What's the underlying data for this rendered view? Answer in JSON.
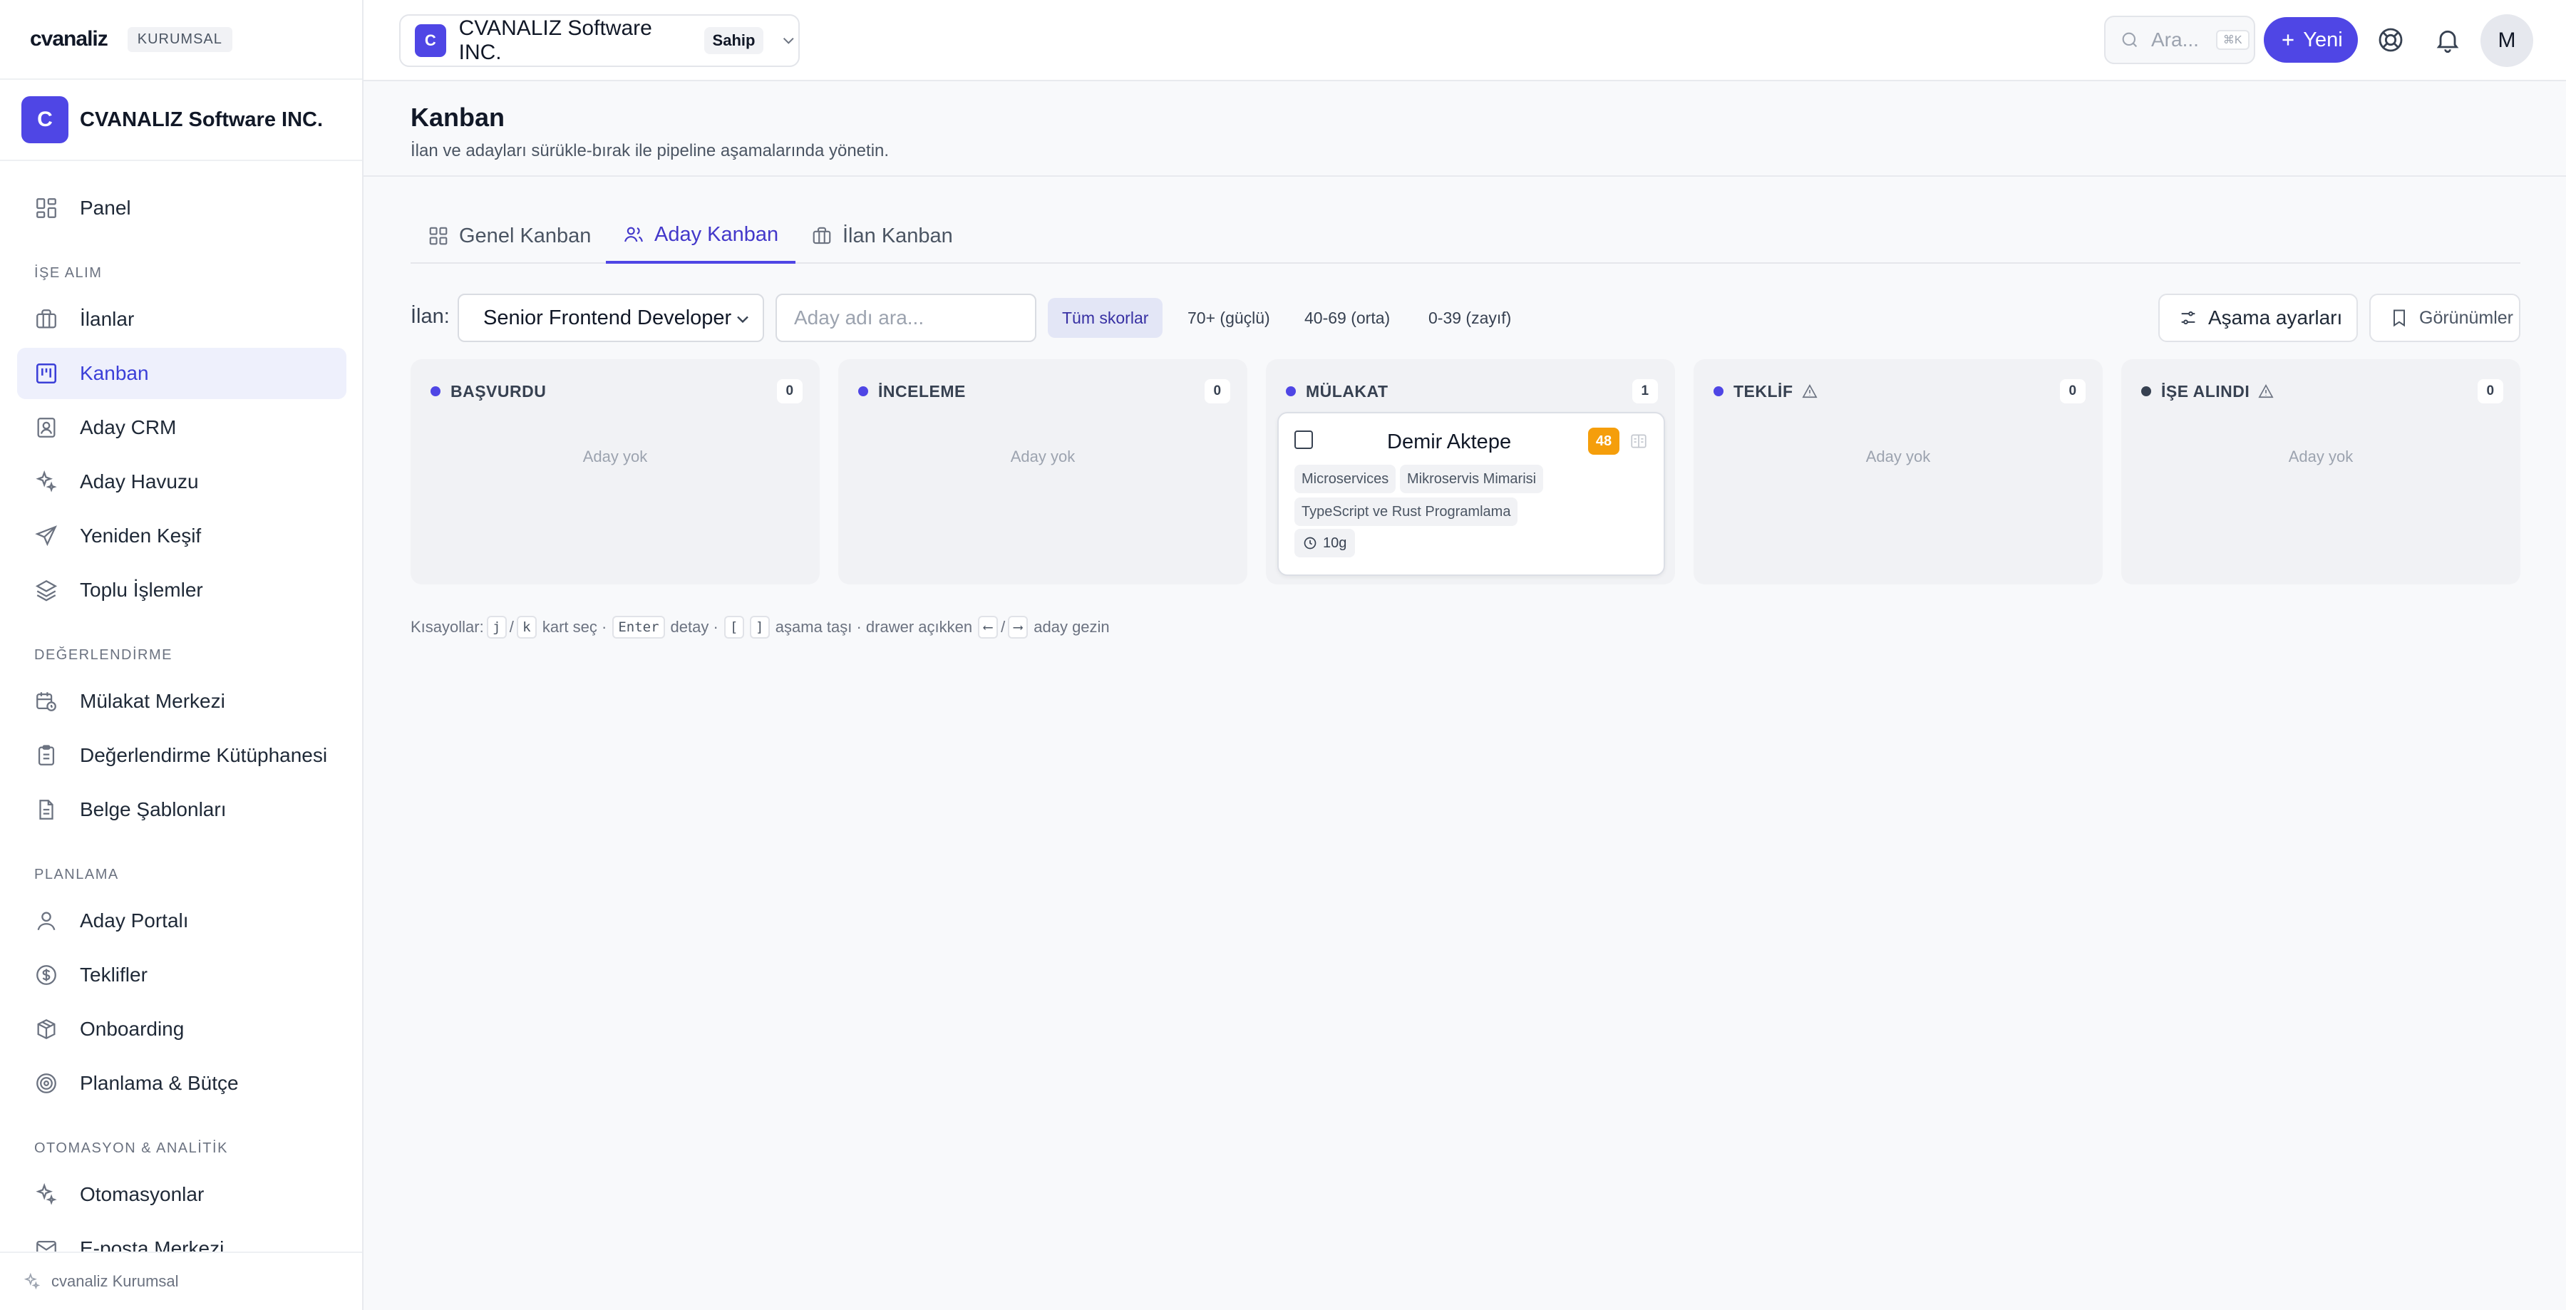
{
  "brand": {
    "logo": "cvanaliz",
    "badge": "KURUMSAL"
  },
  "org": {
    "initial": "C",
    "name": "CVANALIZ Software INC.",
    "role": "Sahip"
  },
  "sidebar": {
    "top_items": [
      {
        "label": "Panel",
        "icon": "dashboard-icon"
      }
    ],
    "sections": [
      {
        "title": "İŞE ALIM",
        "items": [
          {
            "label": "İlanlar",
            "icon": "briefcase-icon"
          },
          {
            "label": "Kanban",
            "icon": "kanban-icon",
            "active": true
          },
          {
            "label": "Aday CRM",
            "icon": "contact-card-icon"
          },
          {
            "label": "Aday Havuzu",
            "icon": "sparkles-icon"
          },
          {
            "label": "Yeniden Keşif",
            "icon": "send-icon"
          },
          {
            "label": "Toplu İşlemler",
            "icon": "layers-icon"
          }
        ]
      },
      {
        "title": "DEĞERLENDİRME",
        "items": [
          {
            "label": "Mülakat Merkezi",
            "icon": "calendar-clock-icon"
          },
          {
            "label": "Değerlendirme Kütüphanesi",
            "icon": "clipboard-icon"
          },
          {
            "label": "Belge Şablonları",
            "icon": "document-icon"
          }
        ]
      },
      {
        "title": "PLANLAMA",
        "items": [
          {
            "label": "Aday Portalı",
            "icon": "user-icon"
          },
          {
            "label": "Teklifler",
            "icon": "dollar-circle-icon"
          },
          {
            "label": "Onboarding",
            "icon": "package-icon"
          },
          {
            "label": "Planlama & Bütçe",
            "icon": "target-icon"
          }
        ]
      },
      {
        "title": "OTOMASYON & ANALİTİK",
        "items": [
          {
            "label": "Otomasyonlar",
            "icon": "sparkles-icon"
          },
          {
            "label": "E-posta Merkezi",
            "icon": "mail-icon"
          }
        ]
      }
    ],
    "footer": "cvanaliz Kurumsal"
  },
  "topbar": {
    "search_placeholder": "Ara...",
    "search_shortcut": "⌘K",
    "new_label": "Yeni",
    "user_initial": "M"
  },
  "page": {
    "title": "Kanban",
    "subtitle": "İlan ve adayları sürükle-bırak ile pipeline aşamalarında yönetin."
  },
  "tabs": [
    {
      "label": "Genel Kanban",
      "icon": "grid-icon"
    },
    {
      "label": "Aday Kanban",
      "icon": "users-icon",
      "active": true
    },
    {
      "label": "İlan Kanban",
      "icon": "briefcase-icon"
    }
  ],
  "filters": {
    "job_label": "İlan:",
    "job_selected": "Senior Frontend Developer",
    "candidate_search_placeholder": "Aday adı ara...",
    "score_chips": [
      {
        "label": "Tüm skorlar",
        "active": true
      },
      {
        "label": "70+ (güçlü)"
      },
      {
        "label": "40-69 (orta)"
      },
      {
        "label": "0-39 (zayıf)"
      }
    ],
    "stage_settings_label": "Aşama ayarları",
    "views_label": "Görünümler"
  },
  "columns": [
    {
      "title": "BAŞVURDU",
      "count": "0",
      "dot_color": "#4f46e5",
      "empty_text": "Aday yok",
      "warn": false
    },
    {
      "title": "İNCELEME",
      "count": "0",
      "dot_color": "#4f46e5",
      "empty_text": "Aday yok",
      "warn": false
    },
    {
      "title": "MÜLAKAT",
      "count": "1",
      "dot_color": "#4f46e5",
      "empty_text": "",
      "warn": false
    },
    {
      "title": "TEKLİF",
      "count": "0",
      "dot_color": "#4f46e5",
      "empty_text": "Aday yok",
      "warn": true
    },
    {
      "title": "İŞE ALINDI",
      "count": "0",
      "dot_color": "#374151",
      "empty_text": "Aday yok",
      "warn": true
    }
  ],
  "card": {
    "name": "Demir Aktepe",
    "score": "48",
    "score_color": "#f59e0b",
    "tags": [
      "Microservices",
      "Mikroservis Mimarisi",
      "TypeScript ve Rust Programlama"
    ],
    "age": "10g"
  },
  "shortcuts": {
    "prefix": "Kısayollar:",
    "k1": "j",
    "s1": "/",
    "k2": "k",
    "t1": "kart seç ·",
    "k3": "Enter",
    "t2": "detay ·",
    "k4": "[",
    "k5": "]",
    "t3": "aşama taşı · drawer açıkken",
    "k6": "⟵",
    "s2": "/",
    "k7": "⟶",
    "t4": "aday gezin"
  },
  "colors": {
    "accent": "#4f46e5",
    "active_bg": "#eef0fc",
    "score_mid": "#f59e0b"
  }
}
